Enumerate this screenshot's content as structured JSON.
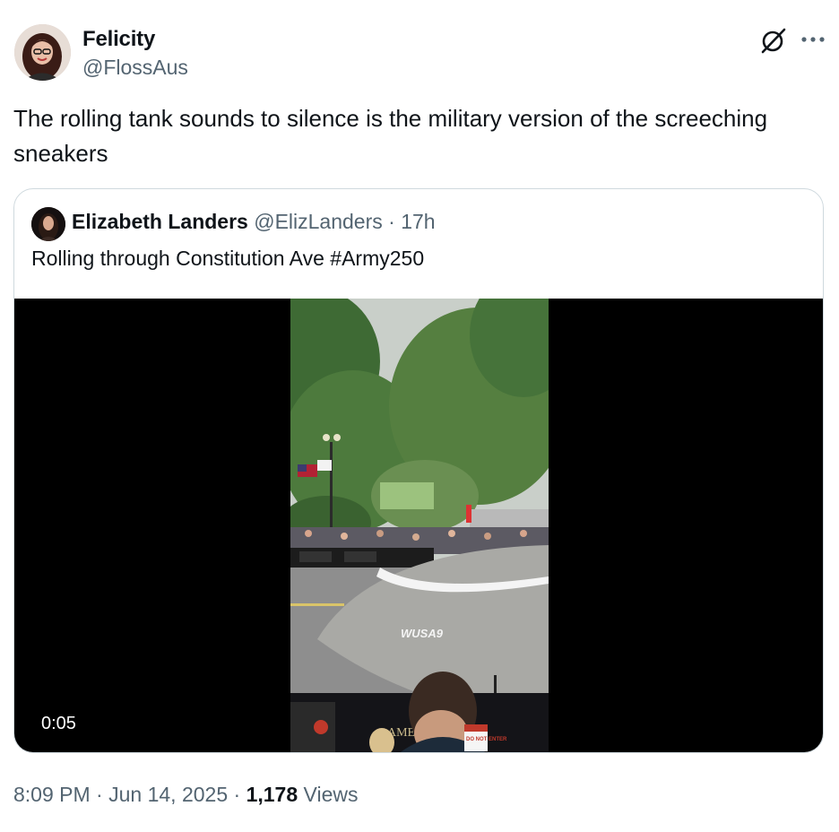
{
  "tweet": {
    "author_name": "Felicity",
    "author_handle": "@FlossAus",
    "text": "The rolling tank sounds to silence is the military version of the screeching sneakers",
    "time": "8:09 PM",
    "date": "Jun 14, 2025",
    "separator": "·",
    "views_count": "1,178",
    "views_label": "Views"
  },
  "quoted_tweet": {
    "author_name": "Elizabeth Landers",
    "author_handle": "@ElizLanders",
    "separator": "·",
    "age": "17h",
    "text": "Rolling through Constitution Ave #Army250",
    "video": {
      "duration": "0:05",
      "umbrella_logo": "WUSA9",
      "sign_text": "DO NOT ENTER",
      "banner_text": "AME"
    }
  },
  "icons": {
    "grok": "grok-icon",
    "more": "more-dots-icon"
  },
  "colors": {
    "text_primary": "#0f1419",
    "text_secondary": "#536471",
    "border": "#cfd9de",
    "media_bg": "#000000"
  }
}
